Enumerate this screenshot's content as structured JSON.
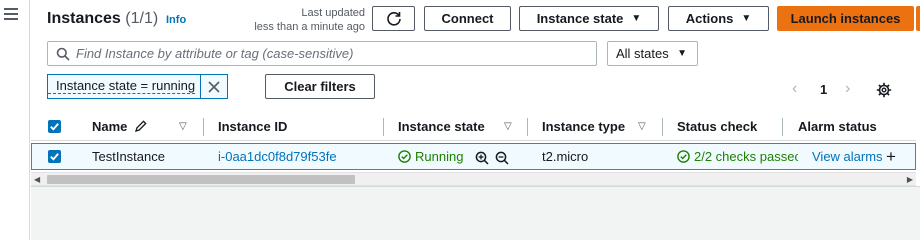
{
  "header": {
    "title": "Instances",
    "count": "(1/1)",
    "info": "Info",
    "last_updated_line1": "Last updated",
    "last_updated_line2": "less than a minute ago"
  },
  "toolbar": {
    "connect": "Connect",
    "instance_state": "Instance state",
    "actions": "Actions",
    "launch": "Launch instances"
  },
  "search": {
    "placeholder": "Find Instance by attribute or tag (case-sensitive)",
    "value": ""
  },
  "states_filter": {
    "selected": "All states"
  },
  "filter_token": {
    "label": "Instance state = running"
  },
  "clear_filters": "Clear filters",
  "pagination": {
    "current_page": "1"
  },
  "table": {
    "columns": [
      "Name",
      "Instance ID",
      "Instance state",
      "Instance type",
      "Status check",
      "Alarm status"
    ],
    "rows": [
      {
        "name": "TestInstance",
        "instance_id": "i-0aa1dc0f8d79f53fe",
        "state": "Running",
        "type": "t2.micro",
        "status_check": "2/2 checks passec",
        "alarm": "View alarms"
      }
    ]
  },
  "colors": {
    "accent": "#0073bb",
    "primary_button": "#ec7211",
    "success": "#1d8102"
  }
}
